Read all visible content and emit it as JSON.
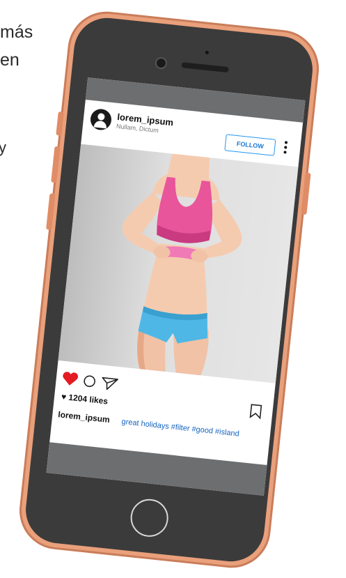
{
  "background_text": {
    "line1": "más",
    "line2": "en",
    "line3": "y"
  },
  "post": {
    "username": "lorem_ipsum",
    "location": "Nullam, Dictum",
    "follow_label": "FOLLOW",
    "likes": "1204 likes",
    "caption_user": "lorem_ipsum",
    "caption_text": "great holidays  #filter #good #island",
    "liked": true
  },
  "colors": {
    "phone_frame": "#e9a07b",
    "screen_bars": "#6d6e70",
    "heart": "#e31b23",
    "follow_accent": "#2196f3",
    "caption_link": "#1565c0",
    "top": "#e8559a",
    "shorts": "#4fb7e6"
  },
  "icons": [
    "avatar-icon",
    "more-icon",
    "heart-icon",
    "comment-icon",
    "share-icon",
    "bookmark-icon"
  ]
}
